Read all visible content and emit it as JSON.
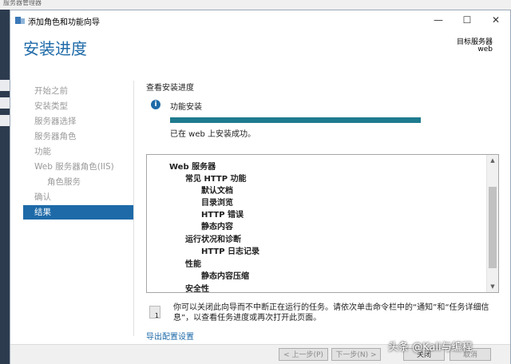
{
  "background_app": {
    "title": "服务器管理器"
  },
  "window": {
    "title": "添加角色和功能向导",
    "controls": {
      "minimize": "—",
      "maximize": "☐",
      "close": "✕"
    }
  },
  "header": {
    "page_title": "安装进度",
    "target_label": "目标服务器",
    "target_name": "web"
  },
  "nav": {
    "items": [
      {
        "label": "开始之前"
      },
      {
        "label": "安装类型"
      },
      {
        "label": "服务器选择"
      },
      {
        "label": "服务器角色"
      },
      {
        "label": "功能"
      },
      {
        "label": "Web 服务器角色(IIS)"
      },
      {
        "label": "角色服务"
      },
      {
        "label": "确认"
      },
      {
        "label": "结果"
      }
    ],
    "active": "结果"
  },
  "content": {
    "section_title": "查看安装进度",
    "feature_label": "功能安装",
    "progress_percent": 100,
    "success_text": "已在 web 上安装成功。",
    "results": [
      {
        "text": "Web 服务器"
      },
      {
        "text": "常见 HTTP 功能"
      },
      {
        "text": "默认文档"
      },
      {
        "text": "目录浏览"
      },
      {
        "text": "HTTP 错误"
      },
      {
        "text": "静态内容"
      },
      {
        "text": "运行状况和诊断"
      },
      {
        "text": "HTTP 日志记录"
      },
      {
        "text": "性能"
      },
      {
        "text": "静态内容压缩"
      },
      {
        "text": "安全性"
      }
    ],
    "note": "你可以关闭此向导而不中断正在运行的任务。请依次单击命令栏中的“通知”和“任务详细信息”，以查看任务进度或再次打开此页面。",
    "export_link": "导出配置设置"
  },
  "footer": {
    "prev": "< 上一步(P)",
    "next": "下一步(N) >",
    "close": "关闭",
    "cancel": "取消"
  },
  "watermark": "头条 @Kali与编程",
  "colors": {
    "accent": "#1e6aa8",
    "progress": "#1e7b8f"
  }
}
